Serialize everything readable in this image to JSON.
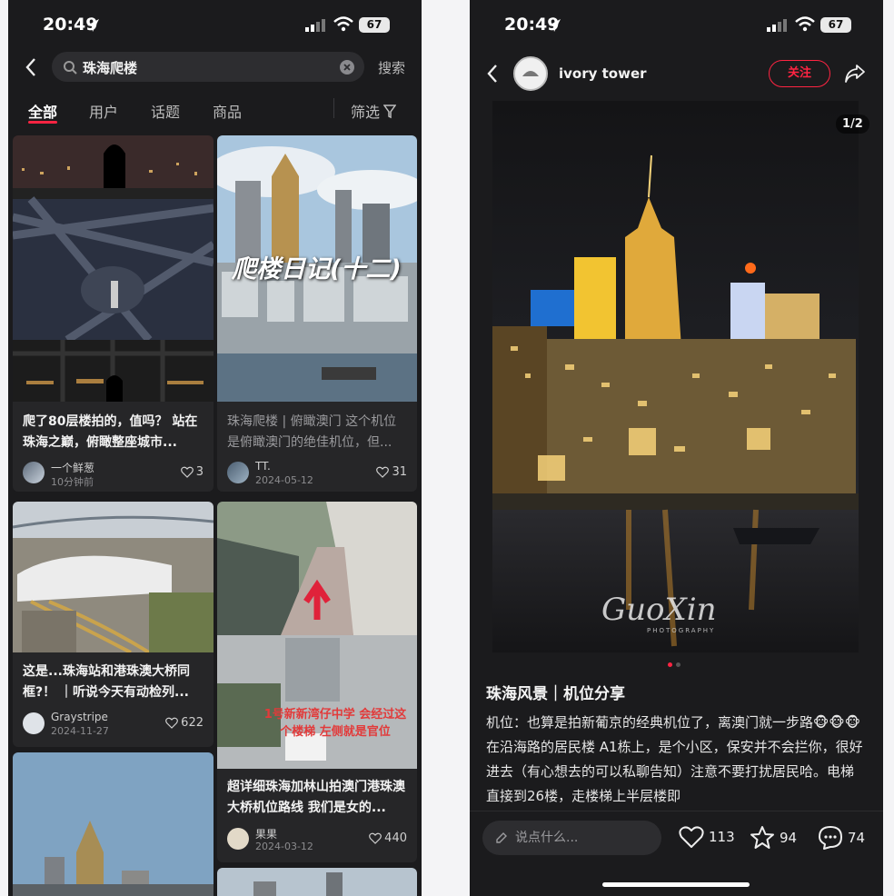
{
  "left": {
    "status": {
      "time": "20:49",
      "battery": "67"
    },
    "search": {
      "query": "珠海爬楼",
      "action": "搜索"
    },
    "tabs": [
      {
        "label": "全部",
        "active": true
      },
      {
        "label": "用户"
      },
      {
        "label": "话题"
      },
      {
        "label": "商品"
      }
    ],
    "filter": "筛选",
    "cards": [
      {
        "title": "爬了80层楼拍的，值吗？ 站在珠海之巅，俯瞰整座城市...",
        "author": "一个鲜葱",
        "date": "10分钟前",
        "likes": "3"
      },
      {
        "title": "珠海爬楼 | 俯瞰澳门 这个机位是俯瞰澳门的绝佳机位，但...",
        "author": "TT.",
        "date": "2024-05-12",
        "likes": "31",
        "overlay": "爬楼日记(十二)"
      },
      {
        "title": "这是...珠海站和港珠澳大桥同框?！ ｜听说今天有动检列...",
        "author": "Graystripe",
        "date": "2024-11-27",
        "likes": "622"
      },
      {
        "title": "超详细珠海加林山拍澳门港珠澳大桥机位路线 我们是女的...",
        "author": "果果",
        "date": "2024-03-12",
        "likes": "440",
        "overlay": "1号新新湾仔中学 会经过这个楼梯 左侧就是官位"
      }
    ]
  },
  "right": {
    "status": {
      "time": "20:49",
      "battery": "67"
    },
    "user": {
      "name": "ivory tower",
      "follow": "关注"
    },
    "pager": "1/2",
    "signature": "GuoXin",
    "signature_sub": "PHOTOGRAPHY",
    "post": {
      "title": "珠海风景｜机位分享",
      "body": "机位：也算是拍新葡京的经典机位了，离澳门就一步路🐵🐵🐵在沿海路的居民楼 A1栋上，是个小区，保安并不会拦你，很好进去（有心想去的可以私聊告知）注意不要打扰居民哈。电梯直接到26楼，走楼梯上半层楼即"
    },
    "comment_placeholder": "说点什么...",
    "actions": {
      "likes": "113",
      "stars": "94",
      "comments": "74"
    }
  }
}
